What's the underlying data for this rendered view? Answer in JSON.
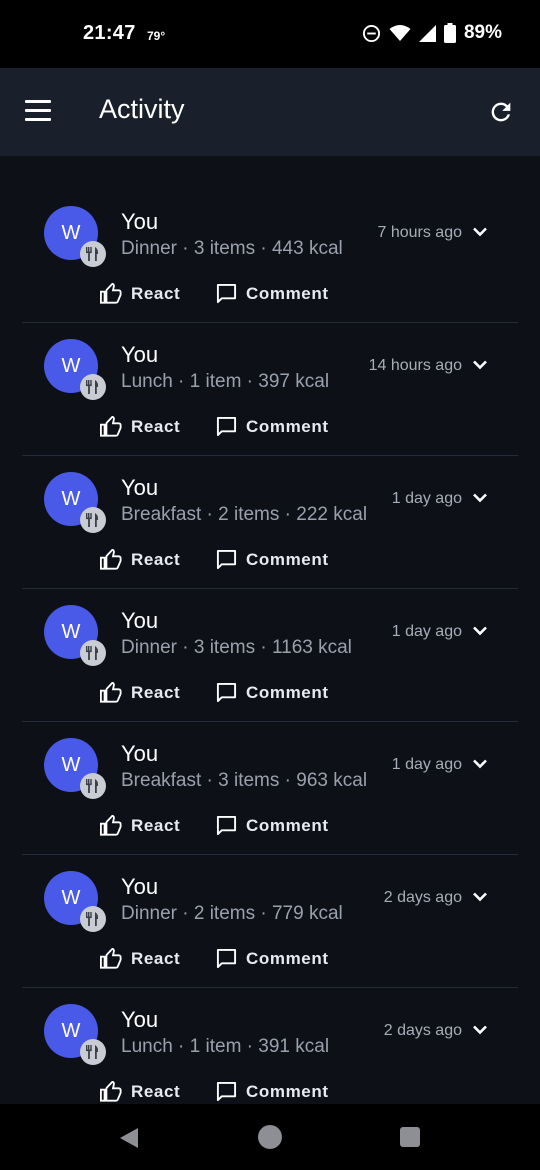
{
  "status_bar": {
    "time": "21:47",
    "temperature": "79°",
    "battery": "89%",
    "icons": [
      "do-not-disturb-icon",
      "wifi-icon",
      "signal-icon",
      "battery-icon"
    ]
  },
  "app_bar": {
    "title": "Activity",
    "menu_icon": "hamburger-menu-icon",
    "refresh_icon": "refresh-icon"
  },
  "colors": {
    "background": "#0d1017",
    "app_bar": "#1a202b",
    "avatar": "#4a5ae8",
    "badge": "#c9ccd2"
  },
  "actions": {
    "react_label": "React",
    "comment_label": "Comment"
  },
  "feed": [
    {
      "avatar": "W",
      "name": "You",
      "summary": "Dinner · 3 items · 443 kcal",
      "time": "7 hours ago"
    },
    {
      "avatar": "W",
      "name": "You",
      "summary": "Lunch · 1 item · 397 kcal",
      "time": "14 hours ago"
    },
    {
      "avatar": "W",
      "name": "You",
      "summary": "Breakfast · 2 items · 222 kcal",
      "time": "1 day ago"
    },
    {
      "avatar": "W",
      "name": "You",
      "summary": "Dinner · 3 items · 1163 kcal",
      "time": "1 day ago"
    },
    {
      "avatar": "W",
      "name": "You",
      "summary": "Breakfast · 3 items · 963 kcal",
      "time": "1 day ago"
    },
    {
      "avatar": "W",
      "name": "You",
      "summary": "Dinner · 2 items · 779 kcal",
      "time": "2 days ago"
    },
    {
      "avatar": "W",
      "name": "You",
      "summary": "Lunch · 1 item · 391 kcal",
      "time": "2 days ago"
    }
  ],
  "nav_bar": {
    "icons": [
      "back-icon",
      "home-icon",
      "recents-icon"
    ]
  }
}
